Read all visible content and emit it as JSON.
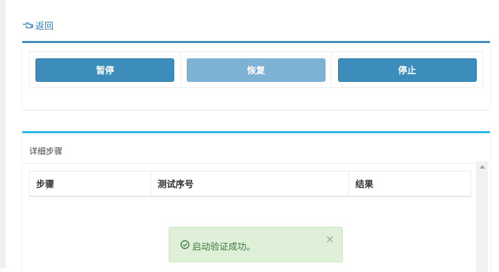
{
  "nav": {
    "back_label": "返回"
  },
  "controls": {
    "pause_label": "暂停",
    "resume_label": "恢复",
    "stop_label": "停止"
  },
  "steps_panel": {
    "title": "详细步骤",
    "columns": [
      "步骤",
      "测试序号",
      "结果"
    ]
  },
  "toast": {
    "message": "启动验证成功。",
    "close_symbol": "×"
  },
  "colors": {
    "primary": "#3c8dbc",
    "primary_disabled": "#7db2d4",
    "panel_accent": "#29b6e6",
    "success_bg": "#dff0d8",
    "success_text": "#3c763d"
  }
}
